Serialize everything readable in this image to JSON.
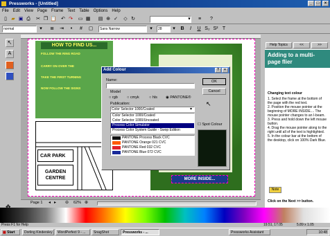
{
  "window": {
    "title": "Pressworks - [Untitled]"
  },
  "menu": [
    "File",
    "Edit",
    "View",
    "Page",
    "Frame",
    "Text",
    "Table",
    "Options",
    "Help"
  ],
  "toolbar2": {
    "style_value": "normal",
    "font_value": "Sans Narrow",
    "size_value": "28",
    "bold": "B",
    "italic": "I",
    "underline": "U",
    "sub": "S₂",
    "sup": "S²",
    "strike": "T"
  },
  "page": {
    "heading": "HOW TO FIND US...",
    "bullets": [
      "FOLLOW THE RING ROAD",
      "CARRY ON OVER THE",
      "TAKE THE FIRST TURNING",
      "NOW FOLLOW THE SIGNS"
    ],
    "car_park": "CAR PARK",
    "garden_centre": "GARDEN CENTRE",
    "more_inside": "MORE INSIDE..."
  },
  "dialog": {
    "title": "Add Colour",
    "name_label": "Name:",
    "name_value": "",
    "model_label": "Model",
    "models": [
      "rgb",
      "cmyk",
      "hls",
      "PANTONE®"
    ],
    "ok": "OK",
    "cancel": "Cancel",
    "publication_label": "Publication:",
    "publication_value": "Color Selector 1000/Coated",
    "publication_options": [
      "Color Selector 1000/Coated",
      "Color Selector 1000/Uncoated",
      "Process Color Simulator",
      "Process Color System Guide - Swop Edition"
    ],
    "colors": [
      {
        "name": "PANTONE Process Black CVC",
        "swatch": "#111111"
      },
      {
        "name": "PANTONE Orange 021 CVC",
        "swatch": "#ff5a00"
      },
      {
        "name": "PANTONE Red 032 CVC",
        "swatch": "#e0202a"
      },
      {
        "name": "PANTONE Blue 072 CVC",
        "swatch": "#1a2a9a"
      }
    ],
    "spot_colour": "Spot Colour"
  },
  "help": {
    "tabs": [
      "Help Topics",
      "<<",
      ">>"
    ],
    "heading": "Adding to a multi-page flier",
    "subheading": "Changing text colour",
    "steps": [
      "1. Select the frame at the bottom of the page with the red text.",
      "2. Position the mouse pointer at the beginning of MORE INSIDE.... The mouse pointer changes to an I-beam.",
      "3. Press and hold down the left mouse button.",
      "4. Drag the mouse pointer along to the right until all of the text is highlighted.",
      "5. In the colour bar at the bottom of the desktop, click on 100% Dark Blue."
    ],
    "note": "Note",
    "next": "Click on the Next >> button."
  },
  "nav": {
    "page_label": "Page 1",
    "zoom": "62%"
  },
  "status": {
    "left": "Press F1 for Help",
    "coords": "19.51, 17.05",
    "size": "5.89 x 1.05"
  },
  "taskbar": {
    "start": "Start",
    "tasks": [
      "Dorling Kindersley Assistant",
      "WordPerfect 9 - ...",
      "SnagShot",
      "Pressworks - ...",
      "Pressworks Assistant"
    ],
    "clock": "10:48"
  }
}
